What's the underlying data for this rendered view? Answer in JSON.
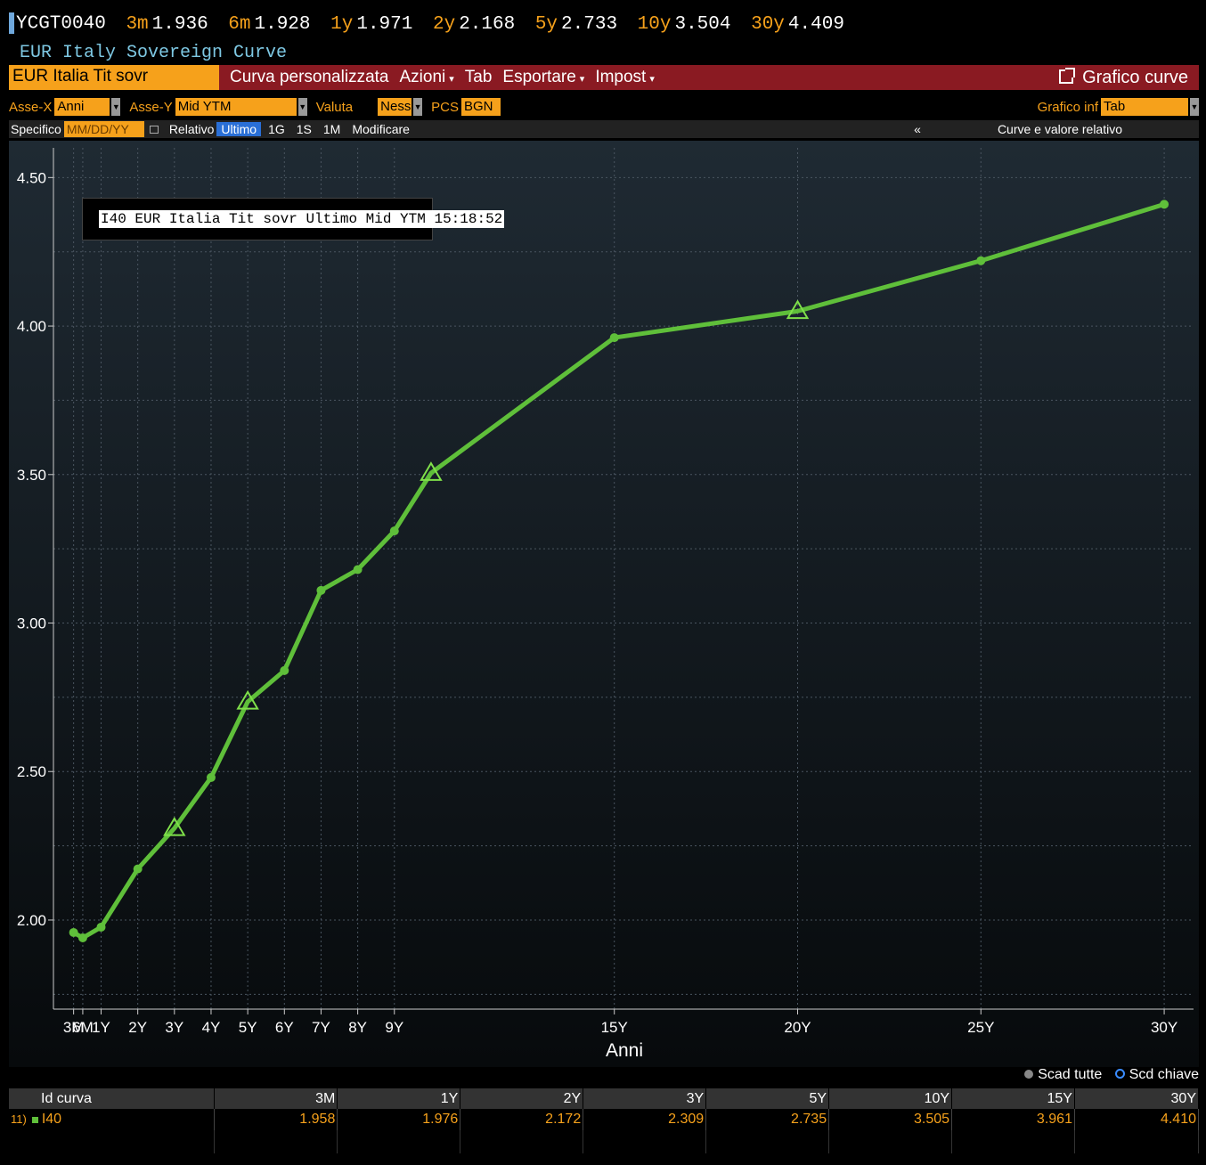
{
  "ticker": {
    "code": "YCGT0040",
    "items": [
      {
        "label": "3m",
        "value": "1.936"
      },
      {
        "label": "6m",
        "value": "1.928"
      },
      {
        "label": "1y",
        "value": "1.971"
      },
      {
        "label": "2y",
        "value": "2.168"
      },
      {
        "label": "5y",
        "value": "2.733"
      },
      {
        "label": "10y",
        "value": "3.504"
      },
      {
        "label": "30y",
        "value": "4.409"
      }
    ],
    "subtitle": "EUR Italy Sovereign Curve"
  },
  "menubar": {
    "curve_name": "EUR Italia Tit sovr",
    "items": [
      "Curva personalizzata",
      "Azioni",
      "Tab",
      "Esportare",
      "Impost"
    ],
    "graph_curves": "Grafico curve"
  },
  "options": {
    "x_axis_label": "Asse-X",
    "x_axis_value": "Anni",
    "y_axis_label": "Asse-Y",
    "y_axis_value": "Mid YTM",
    "currency_label": "Valuta",
    "currency_value": "Ness",
    "pcs_label": "PCS",
    "pcs_value": "BGN",
    "lower_chart_label": "Grafico inf",
    "lower_chart_value": "Tab"
  },
  "spec_row": {
    "specific_label": "Specifico",
    "date_placeholder": "MM/DD/YY",
    "relative_label": "Relativo",
    "buttons": [
      "Ultimo",
      "1G",
      "1S",
      "1M",
      "Modificare"
    ],
    "collapse": "«",
    "curve_relative": "Curve e valore relativo"
  },
  "legend_text": "I40 EUR Italia Tit sovr Ultimo Mid YTM 15:18:52",
  "colors": {
    "line": "#5fbf3a",
    "accent": "#f6a11b",
    "menubar": "#8a1a22"
  },
  "chart_data": {
    "type": "line",
    "xlabel": "Anni",
    "ylabel": "",
    "ylim": [
      1.7,
      4.6
    ],
    "xlim": [
      -0.3,
      30.8
    ],
    "yticks": [
      2.0,
      2.5,
      3.0,
      3.5,
      4.0,
      4.5
    ],
    "ytick_labels": [
      "2.00",
      "2.50",
      "3.00",
      "3.50",
      "4.00",
      "4.50"
    ],
    "xtick_positions": [
      0.25,
      0.5,
      1,
      2,
      3,
      4,
      5,
      6,
      7,
      8,
      9,
      15,
      20,
      25,
      30
    ],
    "xtick_labels": [
      "3M",
      "6M",
      "1Y",
      "2Y",
      "3Y",
      "4Y",
      "5Y",
      "6Y",
      "7Y",
      "8Y",
      "9Y",
      "15Y",
      "20Y",
      "25Y",
      "30Y"
    ],
    "grid": true,
    "series": [
      {
        "name": "I40 EUR Italia Tit sovr Ultimo Mid YTM 15:18:52",
        "x": [
          0.25,
          0.5,
          1,
          2,
          3,
          4,
          5,
          6,
          7,
          8,
          9,
          10,
          15,
          20,
          25,
          30
        ],
        "y": [
          1.958,
          1.94,
          1.976,
          2.172,
          2.309,
          2.48,
          2.735,
          2.84,
          3.11,
          3.18,
          3.31,
          3.505,
          3.961,
          4.05,
          4.22,
          4.41
        ],
        "key_tenors": [
          3,
          5,
          10,
          20
        ]
      }
    ]
  },
  "table": {
    "headers": [
      "Id curva",
      "3M",
      "1Y",
      "2Y",
      "3Y",
      "5Y",
      "10Y",
      "15Y",
      "30Y"
    ],
    "rows": [
      {
        "num": "11)",
        "id": "I40",
        "values": [
          "1.958",
          "1.976",
          "2.172",
          "2.309",
          "2.735",
          "3.505",
          "3.961",
          "4.410"
        ]
      }
    ]
  },
  "scad": {
    "all": "Scad tutte",
    "key": "Scd chiave"
  }
}
